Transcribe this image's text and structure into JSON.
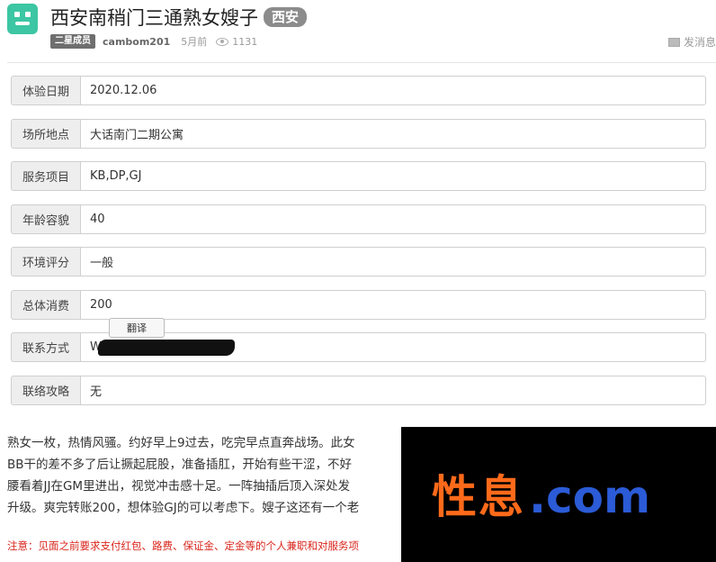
{
  "post": {
    "title": "西安南稍门三通熟女嫂子",
    "city_tag": "西安",
    "rank": "二星成员",
    "username": "cambom201",
    "time": "5月前",
    "views": "1131",
    "pm_label": "发消息"
  },
  "fields": [
    {
      "label": "体验日期",
      "value": "2020.12.06"
    },
    {
      "label": "场所地点",
      "value": "大话南门二期公寓"
    },
    {
      "label": "服务项目",
      "value": "KB,DP,GJ"
    },
    {
      "label": "年龄容貌",
      "value": "40"
    },
    {
      "label": "环境评分",
      "value": "一般"
    },
    {
      "label": "总体消费",
      "value": "200"
    },
    {
      "label": "联系方式",
      "value": "W"
    },
    {
      "label": "联络攻略",
      "value": "无"
    }
  ],
  "translate_button": "翻译",
  "body_lines": [
    "熟女一枚，热情风骚。约好早上9过去，吃完早点直奔战场。此女",
    "BB干的差不多了后让撅起屁股，准备插肛，开始有些干涩，不好",
    "腰看着JJ在GM里进出，视觉冲击感十足。一阵抽插后顶入深处发",
    "升级。爽完转账200，想体验GJ的可以考虑下。嫂子这还有一个老"
  ],
  "notice": "注意：见面之前要求支付红包、路费、保证金、定金等的个人兼职和对服务项",
  "overlay": {
    "brand": "性息",
    "domain": ".com"
  },
  "colors": {
    "avatar": "#3cc6a3",
    "notice": "#d9261c",
    "overlay_brand": "#ff6a1a",
    "overlay_domain": "#2b5bd6"
  }
}
